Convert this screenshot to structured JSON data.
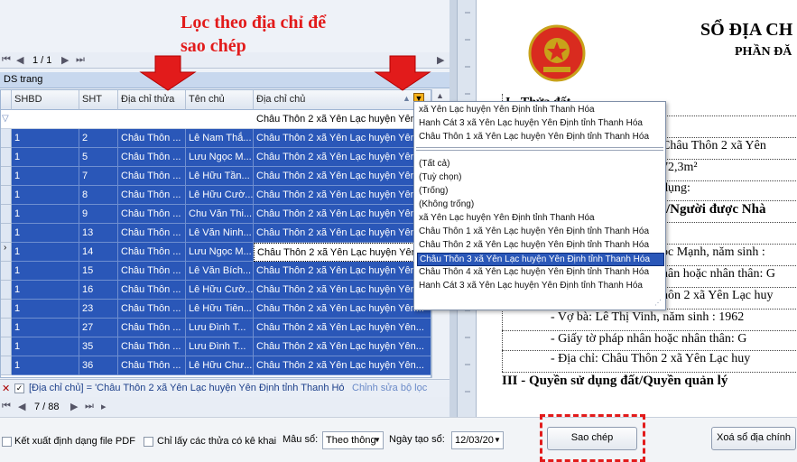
{
  "annotation": {
    "line1": "Lọc theo địa chỉ để",
    "line2": "sao chép"
  },
  "pager_top": {
    "page": "1 / 1"
  },
  "ds_trang": "DS trang",
  "grid": {
    "columns": [
      "SHBD",
      "SHT",
      "Địa chỉ thửa",
      "Tên chủ",
      "Địa chỉ chủ"
    ],
    "filter_value": "Châu Thôn 2 xã Yên Lạc huyện Yên...",
    "rows": [
      [
        "1",
        "2",
        "Châu Thôn ...",
        "Lê Nam Thắ...",
        "Châu Thôn 2 xã Yên Lạc huyện Yên..."
      ],
      [
        "1",
        "5",
        "Châu Thôn ...",
        "Lưu Ngọc M...",
        "Châu Thôn 2 xã Yên Lạc huyện Yên..."
      ],
      [
        "1",
        "7",
        "Châu Thôn ...",
        "Lê Hữu Tần...",
        "Châu Thôn 2 xã Yên Lạc huyện Yên..."
      ],
      [
        "1",
        "8",
        "Châu Thôn ...",
        "Lê Hữu Cườ...",
        "Châu Thôn 2 xã Yên Lạc huyện Yên..."
      ],
      [
        "1",
        "9",
        "Châu Thôn ...",
        "Chu Văn Thi...",
        "Châu Thôn 2 xã Yên Lạc huyện Yên..."
      ],
      [
        "1",
        "13",
        "Châu Thôn ...",
        "Lê Văn Ninh...",
        "Châu Thôn 2 xã Yên Lạc huyện Yên..."
      ],
      [
        "1",
        "14",
        "Châu Thôn ...",
        "Lưu Ngọc M...",
        "Châu Thôn 2 xã Yên Lạc huyện Yên..."
      ],
      [
        "1",
        "15",
        "Châu Thôn ...",
        "Lê Văn Bích...",
        "Châu Thôn 2 xã Yên Lạc huyện Yên..."
      ],
      [
        "1",
        "16",
        "Châu Thôn ...",
        "Lê Hữu Cườ...",
        "Châu Thôn 2 xã Yên Lạc huyện Yên..."
      ],
      [
        "1",
        "23",
        "Châu Thôn ...",
        "Lê Hữu Tiên...",
        "Châu Thôn 2 xã Yên Lạc huyện Yên..."
      ],
      [
        "1",
        "27",
        "Châu Thôn ...",
        "Lưu Đình T...",
        "Châu Thôn 2 xã Yên Lạc huyện Yên..."
      ],
      [
        "1",
        "35",
        "Châu Thôn ...",
        "Lưu Đình T...",
        "Châu Thôn 2 xã Yên Lạc huyện Yên..."
      ],
      [
        "1",
        "36",
        "Châu Thôn ...",
        "Lê Hữu Chư...",
        "Châu Thôn 2 xã Yên Lạc huyện Yên..."
      ]
    ]
  },
  "filter_bar": {
    "text": "[Địa chỉ chủ] = 'Châu Thôn 2 xã Yên Lạc huyện Yên Định tỉnh Thanh Hóa'",
    "edit_link": "Chỉnh sửa bộ lọc"
  },
  "pager_bottom": {
    "page": "7 / 88"
  },
  "dropdown": {
    "recent": [
      "xã Yên Lạc huyện Yên Định tỉnh Thanh Hóa",
      "Hanh Cát 3 xã Yên Lạc huyện Yên Định tỉnh Thanh Hóa",
      "Châu Thôn 1 xã Yên Lạc huyện Yên Định tỉnh Thanh Hóa"
    ],
    "items": [
      "(Tất cả)",
      "(Tuỳ chọn)",
      "(Trống)",
      "(Không trống)",
      " xã Yên Lạc huyện Yên Định tỉnh Thanh Hóa",
      "Châu Thôn 1 xã Yên Lạc huyện Yên Định tỉnh Thanh Hóa",
      "Châu Thôn 2 xã Yên Lạc huyện Yên Định tỉnh Thanh Hóa",
      "Châu Thôn 3 xã Yên Lạc huyện Yên Định tỉnh Thanh Hóa",
      "Châu Thôn 4 xã Yên Lạc huyện Yên Định tỉnh Thanh Hóa",
      "Hanh Cát 3 xã Yên Lạc huyện Yên Định tỉnh Thanh Hóa"
    ],
    "highlighted_index": 7
  },
  "doc": {
    "title": "SỔ ĐỊA CH",
    "subtitle": "PHẦN ĐĂ",
    "lines": [
      "I - Thửa đất",
      "Châu Thôn 2 xã Yên",
      "72,3m²",
      "dụng:",
      "t/Người được Nhà",
      "",
      "ọc Mạnh, năm sinh :",
      "nân hoặc nhân thân: G",
      "hôn 2 xã Yên Lạc huy",
      "- Vợ bà: Lê Thị Vinh, năm sinh : 1962",
      "- Giấy tờ pháp nhân hoặc nhân thân:  G",
      "- Địa chỉ: Châu Thôn 2 xã Yên Lạc huy"
    ],
    "section3": "III - Quyền sử dụng đất/Quyền quản lý"
  },
  "bottom": {
    "export_pdf": "Kết xuất định dạng file PDF",
    "only_declared": "Chỉ lấy các thửa có kê khai",
    "mau_so_label": "Mẫu sổ:",
    "mau_so_value": "Theo thông",
    "ngay_tao_label": "Ngày tạo sổ:",
    "ngay_tao_value": "12/03/20",
    "copy_button": "Sao chép",
    "delete_button": "Xoá sổ địa chính"
  },
  "colors": {
    "selection": "#2a57b8",
    "annotation": "#e21b1b"
  }
}
